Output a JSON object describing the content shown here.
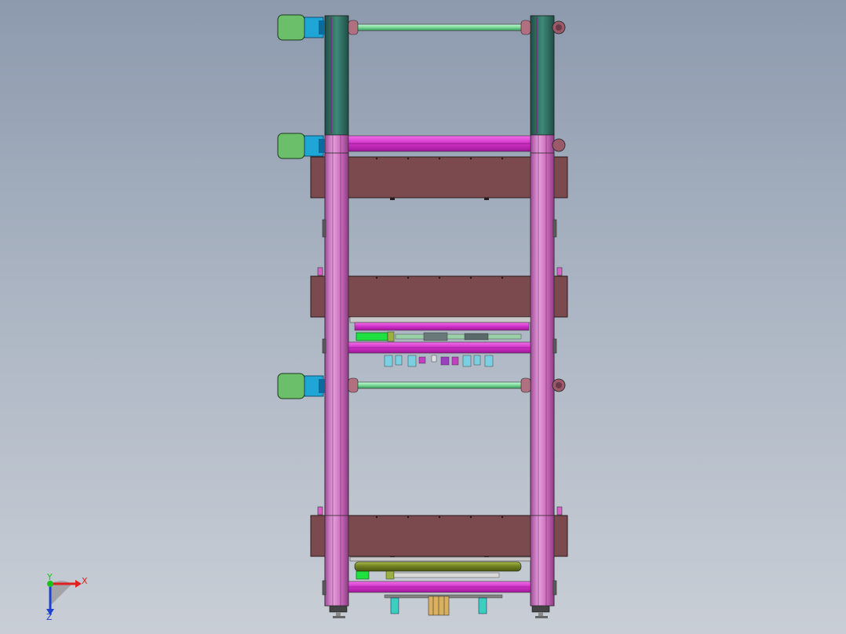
{
  "triad": {
    "x_label": "X",
    "y_label": "Y",
    "z_label": "Z"
  },
  "colors": {
    "frame_magenta": "#d878c8",
    "rail_teal": "#2f6e62",
    "beam_maroon": "#7a4a4e",
    "motor_green": "#6cbf6a",
    "motor_cyan": "#1fa6d6",
    "shaft_green": "#8ee8a8",
    "beam_magenta": "#e040d8",
    "roller_olive": "#7a8a28"
  }
}
